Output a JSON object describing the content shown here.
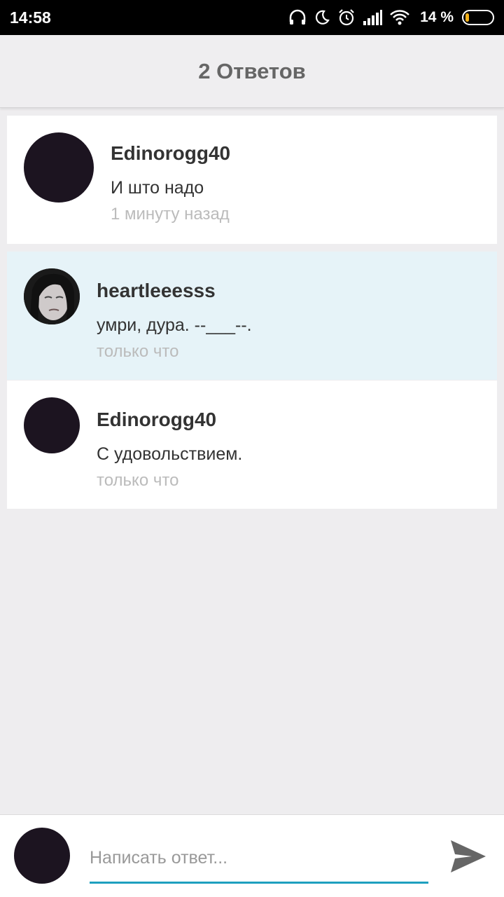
{
  "status_bar": {
    "time": "14:58",
    "battery_percent": "14 %",
    "battery_level": 0.14,
    "icons": [
      "headphones-icon",
      "moon-icon",
      "alarm-icon",
      "signal-icon",
      "wifi-icon",
      "battery-icon"
    ],
    "battery_color": "#f3b21a"
  },
  "app_bar": {
    "title": "2 Ответов"
  },
  "comments": [
    {
      "author": "Edinorogg40",
      "text": "И што надо",
      "time": "1 минуту назад"
    },
    {
      "author": "heartleeesss",
      "text": "умри, дура. --___--.",
      "time": "только что"
    },
    {
      "author": "Edinorogg40",
      "text": "С удовольствием.",
      "time": "только что"
    }
  ],
  "reply": {
    "placeholder": "Написать ответ...",
    "send_icon": "send-icon"
  },
  "colors": {
    "accent": "#1ea0bf",
    "highlight": "#e6f3f8",
    "avatar": "#1c1420"
  }
}
